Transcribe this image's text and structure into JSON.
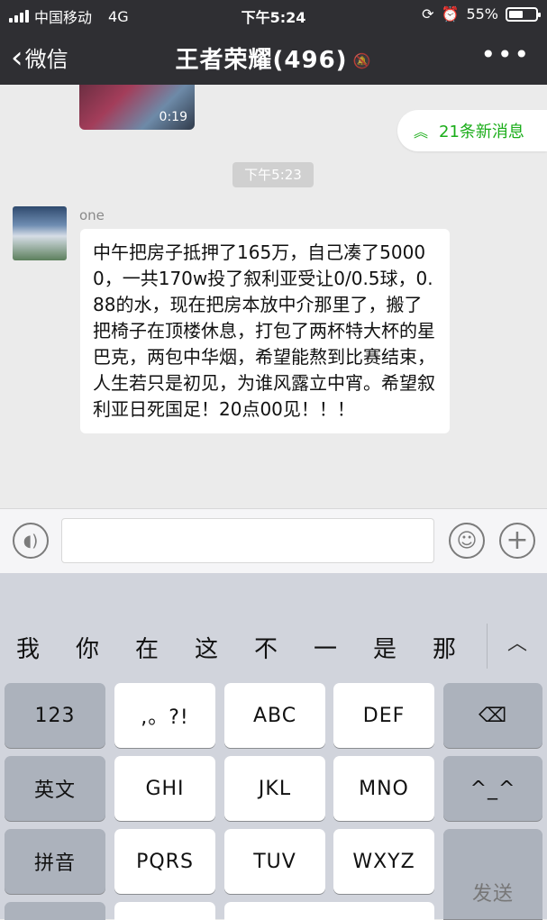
{
  "status": {
    "carrier": "中国移动",
    "network": "4G",
    "time": "下午5:24",
    "battery": "55%",
    "battery_level": 0.55
  },
  "nav": {
    "back_label": "微信",
    "title": "王者荣耀(496)",
    "more_icon": "more-icon",
    "mute_icon": "bell-slash-icon"
  },
  "chat": {
    "video_duration": "0:19",
    "new_messages": "21条新消息",
    "timestamp": "下午5:23",
    "sender": "one",
    "message": "中午把房子抵押了165万，自己凑了50000，一共170w投了叙利亚受让0/0.5球，0.88的水，现在把房本放中介那里了，搬了把椅子在顶楼休息，打包了两杯特大杯的星巴克，两包中华烟，希望能熬到比赛结束，人生若只是初见，为谁风露立中宵。希望叙利亚日死国足！20点00见！！！"
  },
  "input": {
    "value": ""
  },
  "keyboard": {
    "candidates": [
      "我",
      "你",
      "在",
      "这",
      "不",
      "一",
      "是",
      "那"
    ],
    "keys": {
      "num": "123",
      "punct": ",。?!",
      "abc": "ABC",
      "def": "DEF",
      "english": "英文",
      "ghi": "GHI",
      "jkl": "JKL",
      "mno": "MNO",
      "emoticon": "^_^",
      "pinyin": "拼音",
      "pqrs": "PQRS",
      "tuv": "TUV",
      "wxyz": "WXYZ",
      "send": "发送"
    }
  },
  "colors": {
    "header": "#2f2f33",
    "accent": "#1aad19",
    "chat_bg": "#ebebeb",
    "keyboard_bg": "#d1d4dc"
  }
}
